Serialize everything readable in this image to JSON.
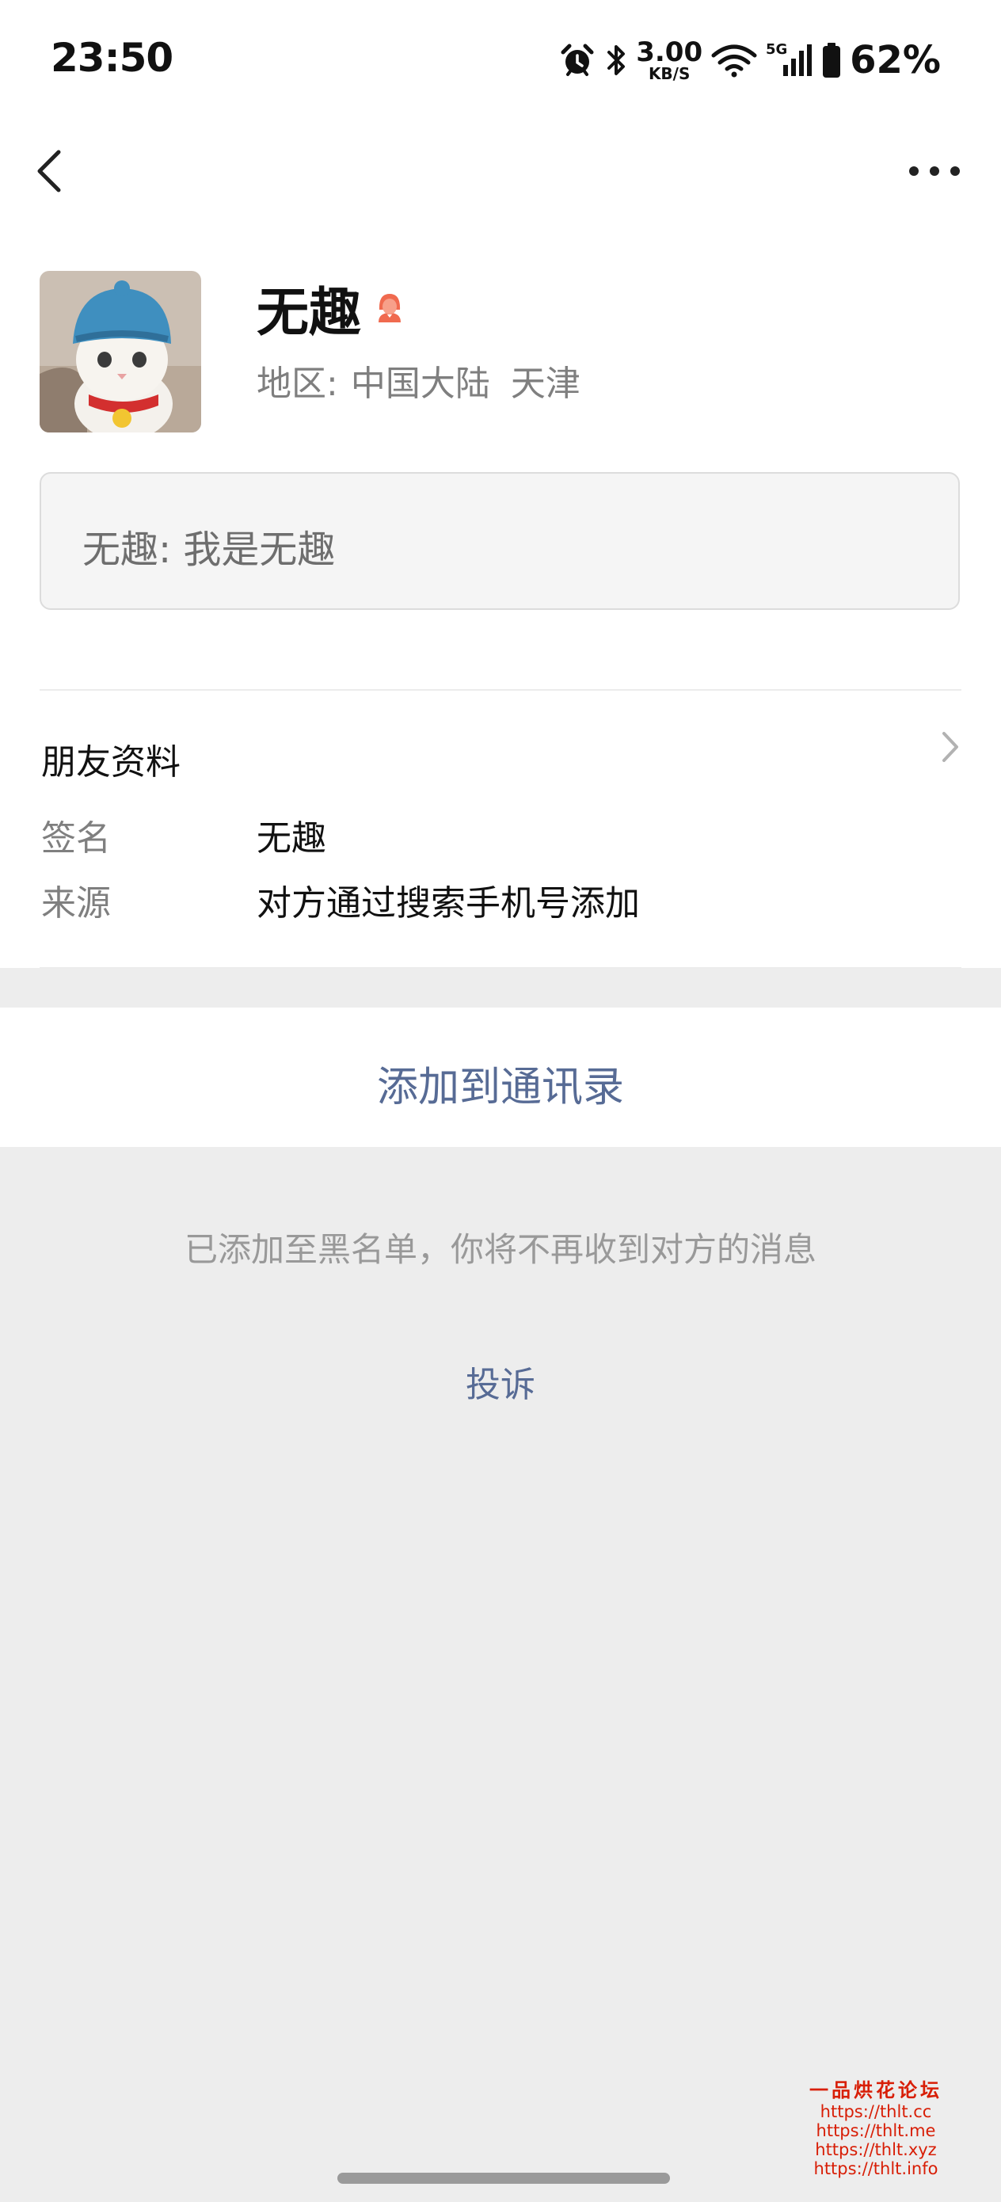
{
  "status_bar": {
    "time": "23:50",
    "network_speed": "3.00",
    "network_speed_unit": "KB/S",
    "signal_type": "5G",
    "battery": "62%",
    "icons": [
      "alarm-icon",
      "bluetooth-icon",
      "wifi-icon",
      "signal-icon",
      "battery-icon"
    ]
  },
  "nav": {
    "back_icon": "chevron-left-icon",
    "more_icon": "more-dots-icon"
  },
  "profile": {
    "name": "无趣",
    "gender_icon": "female-icon",
    "region_label": "地区:",
    "region_country": "中国大陆",
    "region_city": "天津"
  },
  "greeting": {
    "text": "无趣: 我是无趣"
  },
  "friend_info": {
    "title": "朋友资料",
    "rows": [
      {
        "label": "签名",
        "value": "无趣"
      },
      {
        "label": "来源",
        "value": "对方通过搜索手机号添加"
      }
    ]
  },
  "actions": {
    "add_to_contacts": "添加到通讯录",
    "blacklist_notice": "已添加至黑名单，你将不再收到对方的消息",
    "complain": "投诉"
  },
  "watermark": {
    "title": "一品烘花论坛",
    "links": [
      "https://thlt.cc",
      "https://thlt.me",
      "https://thlt.xyz",
      "https://thlt.info"
    ]
  },
  "colors": {
    "link_blue": "#576b95",
    "background_gray": "#ededed",
    "watermark_red": "#d81e06",
    "female_icon": "#f06a4f"
  }
}
